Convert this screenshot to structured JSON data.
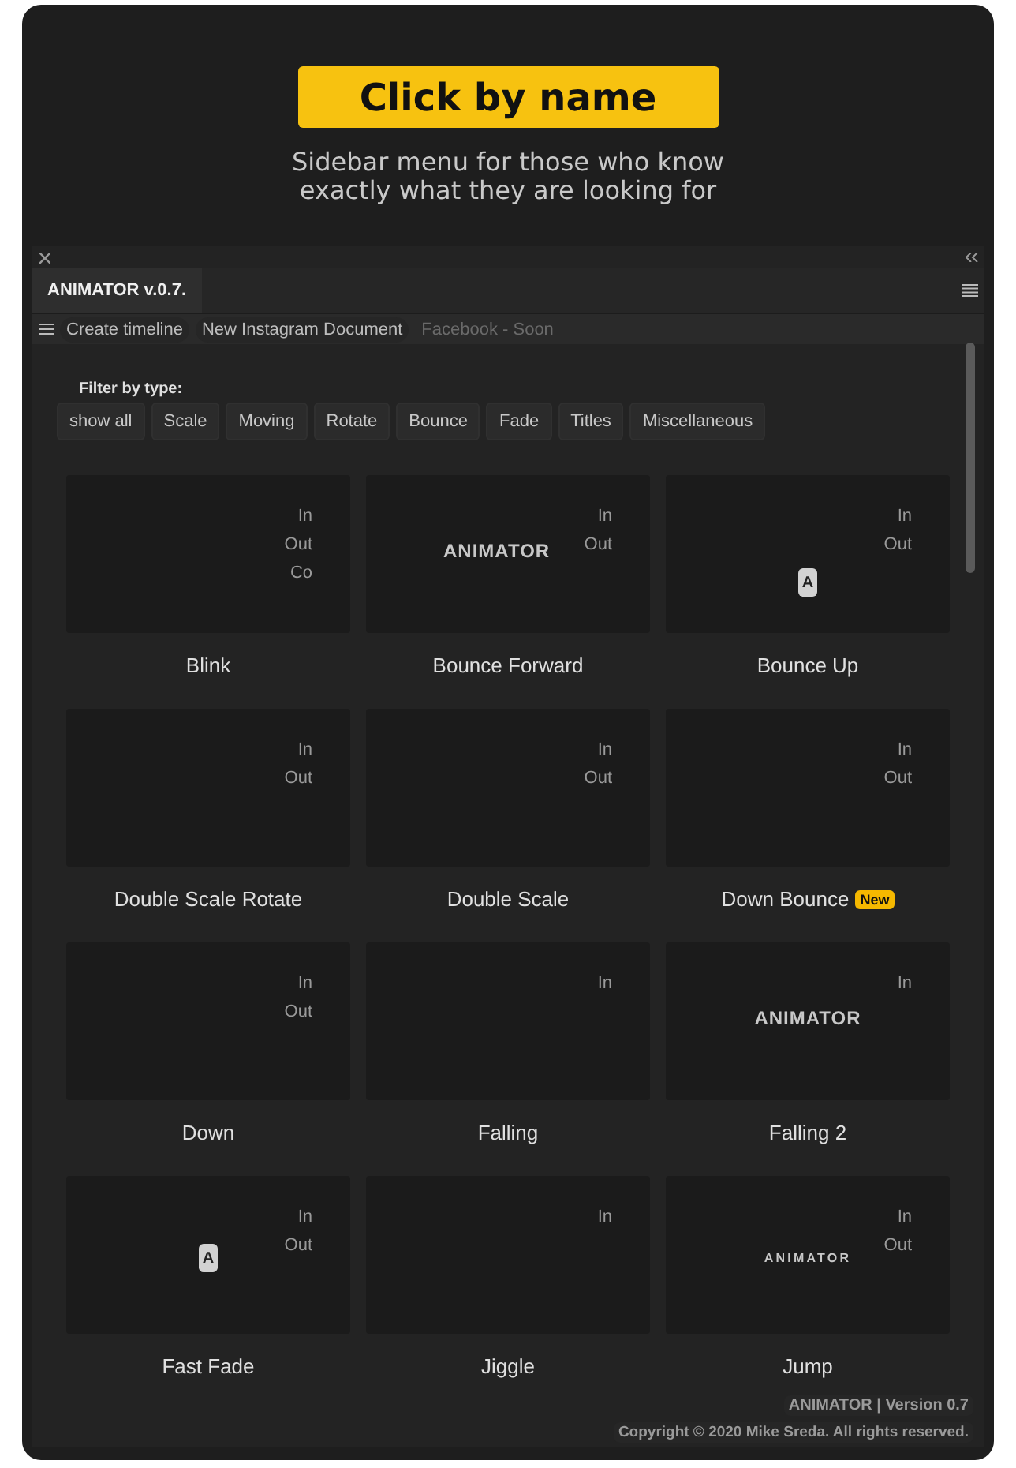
{
  "banner": {
    "title": "Click by name",
    "subtitle_lines": [
      "Sidebar menu for those who know",
      "exactly what they are looking for"
    ]
  },
  "panel": {
    "tab": "ANIMATOR v.0.7.",
    "toolbar": [
      {
        "label": "Create timeline",
        "disabled": false
      },
      {
        "label": "New Instagram Document",
        "disabled": false
      },
      {
        "label": "Facebook - Soon",
        "disabled": true
      }
    ],
    "filter_label": "Filter by type:",
    "filters": [
      "show all",
      "Scale",
      "Moving",
      "Rotate",
      "Bounce",
      "Fade",
      "Titles",
      "Miscellaneous"
    ],
    "cards": [
      {
        "name": "Blink",
        "options": [
          "In",
          "Out",
          "Co"
        ],
        "preview": {
          "kind": "blank"
        }
      },
      {
        "name": "Bounce Forward",
        "options": [
          "In",
          "Out"
        ],
        "preview": {
          "kind": "logo",
          "text": "ANIMATOR"
        }
      },
      {
        "name": "Bounce Up",
        "options": [
          "In",
          "Out"
        ],
        "preview": {
          "kind": "key",
          "text": "A"
        }
      },
      {
        "name": "Double Scale Rotate",
        "options": [
          "In",
          "Out"
        ],
        "preview": {
          "kind": "blank"
        }
      },
      {
        "name": "Double Scale",
        "options": [
          "In",
          "Out"
        ],
        "preview": {
          "kind": "blank"
        }
      },
      {
        "name": "Down Bounce",
        "badge": "New",
        "options": [
          "In",
          "Out"
        ],
        "preview": {
          "kind": "blank"
        }
      },
      {
        "name": "Down",
        "options": [
          "In",
          "Out"
        ],
        "preview": {
          "kind": "blank"
        }
      },
      {
        "name": "Falling",
        "options": [
          "In"
        ],
        "preview": {
          "kind": "blank"
        }
      },
      {
        "name": "Falling 2",
        "options": [
          "In"
        ],
        "preview": {
          "kind": "logo-center",
          "text": "ANIMATOR"
        }
      },
      {
        "name": "Fast Fade",
        "options": [
          "In",
          "Out"
        ],
        "preview": {
          "kind": "key-left",
          "text": "A"
        }
      },
      {
        "name": "Jiggle",
        "options": [
          "In"
        ],
        "preview": {
          "kind": "blank"
        }
      },
      {
        "name": "Jump",
        "options": [
          "In",
          "Out"
        ],
        "preview": {
          "kind": "wide-logo",
          "text": "ANIMATOR"
        }
      }
    ],
    "footer": {
      "version": "ANIMATOR | Version 0.7",
      "copyright": "Copyright © 2020 Mike Sreda. All rights reserved."
    }
  }
}
